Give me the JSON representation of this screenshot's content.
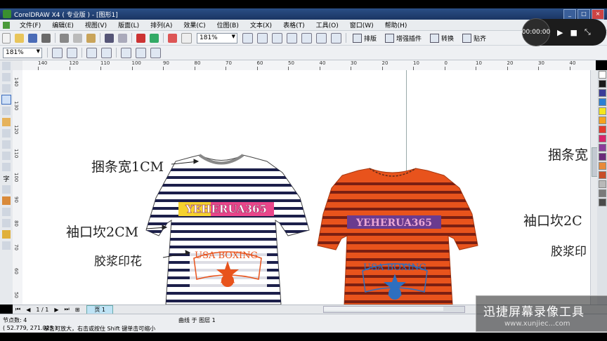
{
  "window": {
    "title": "CorelDRAW X4 ( 专业版 ) - [图形1]"
  },
  "menu": [
    "文件(F)",
    "编辑(E)",
    "视图(V)",
    "版面(L)",
    "排列(A)",
    "效果(C)",
    "位图(B)",
    "文本(X)",
    "表格(T)",
    "工具(O)",
    "窗口(W)",
    "帮助(H)"
  ],
  "toolbar": {
    "zoom_value": "181%",
    "plugins": [
      "排版",
      "增强插件",
      "转换",
      "贴齐"
    ]
  },
  "toolbar2": {
    "zoom_value": "181%"
  },
  "ruler_top_ticks": [
    "140",
    "120",
    "110",
    "100",
    "90",
    "80",
    "70",
    "60",
    "50",
    "40",
    "30",
    "20",
    "10",
    "0",
    "10",
    "20",
    "30",
    "40"
  ],
  "ruler_left_ticks": [
    "140",
    "130",
    "120",
    "110",
    "100",
    "90",
    "80",
    "70",
    "60",
    "50"
  ],
  "canvas": {
    "white_shirt": {
      "label_top": "捆条宽1CM",
      "label_mid": "袖口坎2CM",
      "label_bottom": "胶浆印花",
      "print_top": "YEHERUA365",
      "print_bottom": "USA BOXING"
    },
    "orange_shirt": {
      "print_top": "YEHERUA365",
      "print_bottom": "USA BOXING"
    },
    "right_labels": [
      "捆条宽",
      "袖口坎2C",
      "胶浆印"
    ]
  },
  "colors": {
    "navy_stripe": "#1c1f4a",
    "orange": "#e8531c",
    "blue_print": "#2e6fbf",
    "pink": "#e9458a",
    "yellow": "#f5d22e"
  },
  "palette": [
    "#ffffff",
    "#1a1a1a",
    "#3b3b98",
    "#2a7fd4",
    "#f4e61c",
    "#f5a21e",
    "#e43a2d",
    "#d9246b",
    "#8c3a9b",
    "#6b2a7a",
    "#e88a3a",
    "#c84e2a",
    "#b9b9b9",
    "#7a7a7a",
    "#4a4a4a"
  ],
  "pagebar": {
    "page_count": "1 / 1",
    "page_tab": "页 1"
  },
  "status": {
    "nodes": "节点数: 4",
    "layer": "曲线 于 图层 1",
    "coords": "( 52.779, 271.025 )",
    "hint": "单击可放大，右击或按住 Shift 键单击可缩小"
  },
  "recorder": {
    "time": "00:00:00"
  },
  "watermark": {
    "text": "迅捷屏幕录像工具",
    "url": "www.xunjiec...com"
  }
}
